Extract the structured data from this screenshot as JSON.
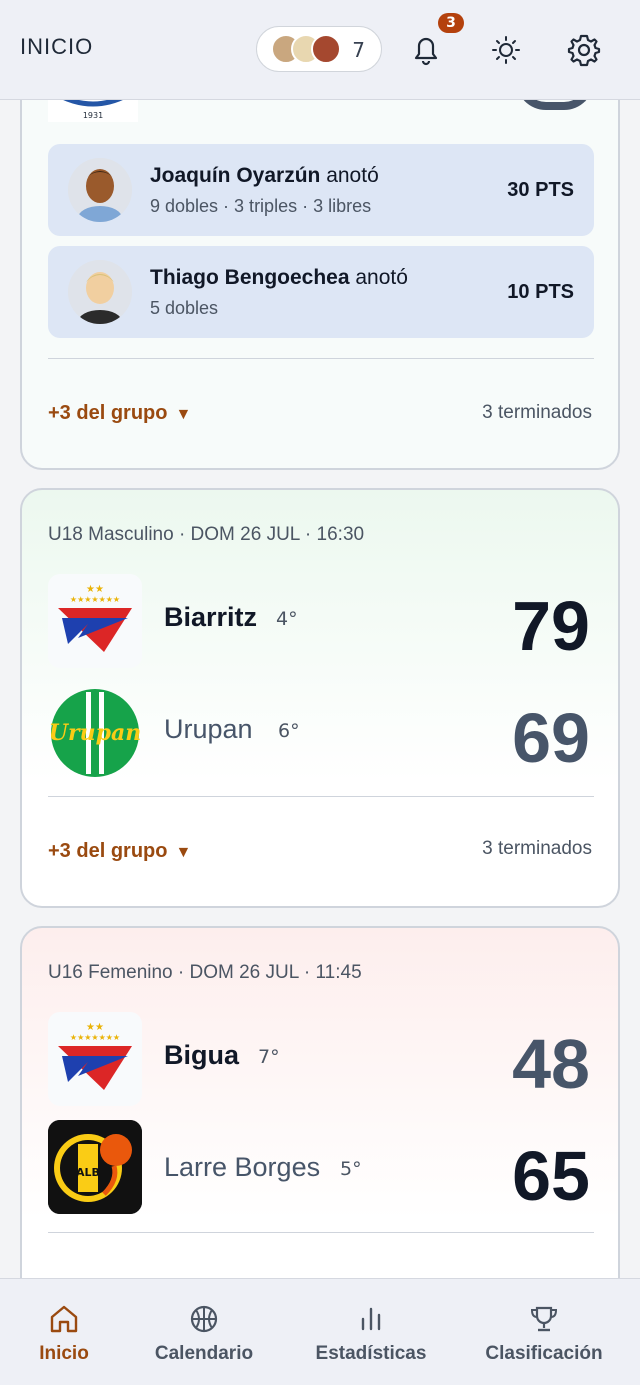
{
  "header": {
    "title": "INICIO",
    "favorites_count": "7",
    "notifications_badge": "3",
    "icons": [
      "bell-icon",
      "sun-icon",
      "gear-icon"
    ]
  },
  "top_card": {
    "logo_caption": "1931",
    "scorers": [
      {
        "name": "Joaquín Oyarzún",
        "verb": "anotó",
        "detail": "9 dobles · 3 triples · 3 libres",
        "points": "30 PTS"
      },
      {
        "name": "Thiago Bengoechea",
        "verb": "anotó",
        "detail": "5 dobles",
        "points": "10 PTS"
      }
    ],
    "group_link": "+3 del grupo",
    "finished": "3 terminados"
  },
  "games": [
    {
      "meta": "U18 Masculino · DOM 26 JUL · 16:30",
      "home": {
        "name": "Biarritz",
        "rank": "4°",
        "score": "79"
      },
      "away": {
        "name": "Urupan",
        "rank": "6°",
        "score": "69",
        "logo_text": "Urupan"
      },
      "group_link": "+3 del grupo",
      "finished": "3 terminados"
    },
    {
      "meta": "U16 Femenino · DOM 26 JUL · 11:45",
      "home": {
        "name": "Bigua",
        "rank": "7°",
        "score": "48"
      },
      "away": {
        "name": "Larre Borges",
        "rank": "5°",
        "score": "65",
        "logo_text": "ALB"
      }
    }
  ],
  "nav": [
    {
      "label": "Inicio",
      "icon": "home-icon",
      "active": true
    },
    {
      "label": "Calendario",
      "icon": "basketball-icon",
      "active": false
    },
    {
      "label": "Estadísticas",
      "icon": "bar-chart-icon",
      "active": false
    },
    {
      "label": "Clasificación",
      "icon": "trophy-icon",
      "active": false
    }
  ],
  "colors": {
    "accent": "#9a4a10",
    "badge": "#b4410d",
    "win_green": "#ecf8ef",
    "loss_red": "#fdeeed"
  }
}
